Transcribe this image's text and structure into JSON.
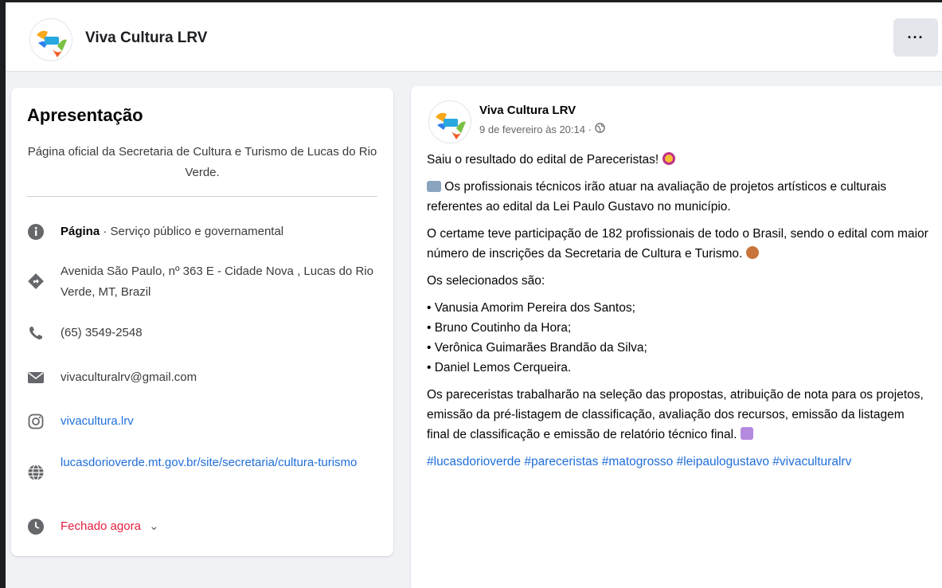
{
  "header": {
    "page_name": "Viva Cultura LRV",
    "more_label": "···"
  },
  "intro": {
    "title": "Apresentação",
    "description": "Página oficial da Secretaria de Cultura e Turismo de Lucas do Rio Verde.",
    "category_label": "Página",
    "category_value": " · Serviço público e governamental",
    "address": "Avenida São Paulo, nº 363 E - Cidade Nova , Lucas do Rio Verde, MT, Brazil",
    "phone": "(65) 3549-2548",
    "email": "vivaculturalrv@gmail.com",
    "instagram": "vivacultura.lrv",
    "website": "lucasdorioverde.mt.gov.br/site/secretaria/cultura-turismo",
    "hours": "Fechado agora",
    "hours_chevron": "⌄"
  },
  "post": {
    "author": "Viva Cultura LRV",
    "date": "9 de fevereiro às 20:14 ·",
    "p1": "Saiu o resultado do edital de Pareceristas!",
    "p2": " Os profissionais técnicos irão atuar na avaliação de projetos artísticos e culturais referentes ao edital da Lei Paulo Gustavo no município.",
    "p3": "O certame teve participação de 182 profissionais de todo o Brasil, sendo o edital com maior número de inscrições da Secretaria de Cultura e Turismo.",
    "p4": "Os selecionados são:",
    "selected": [
      "• Vanusia Amorim Pereira dos Santos;",
      "• Bruno Coutinho da Hora;",
      "• Verônica Guimarães Brandão da Silva;",
      "• Daniel Lemos Cerqueira."
    ],
    "p5": "Os pareceristas trabalharão na seleção das propostas, atribuição de nota para os projetos, emissão da pré-listagem de classificação, avaliação dos recursos, emissão da listagem final de classificação e emissão de relatório técnico final.",
    "hashtags": "#lucasdorioverde #pareceristas #matogrosso #leipaulogustavo #vivaculturalrv"
  },
  "icons": {
    "info": "info-icon",
    "address": "directions-icon",
    "phone": "phone-icon",
    "email": "envelope-icon",
    "instagram": "instagram-icon",
    "website": "globe-icon",
    "hours": "clock-icon",
    "audience": "globe-icon"
  },
  "colors": {
    "link": "#216fdb",
    "closed": "#e41e3f",
    "background": "#f0f2f5"
  }
}
